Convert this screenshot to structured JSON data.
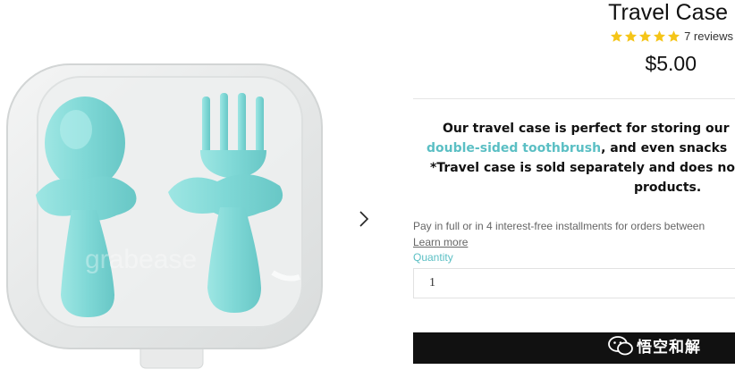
{
  "product": {
    "title": "Travel Case",
    "rating_value": 5,
    "rating_max": 5,
    "reviews_label": "7 reviews",
    "price": "$5.00"
  },
  "description": {
    "line1": "Our travel case is perfect for storing our",
    "link_text": "double-sided toothbrush",
    "line2_rest": ", and even snacks",
    "line3": "*Travel case is sold separately and does no",
    "line4": "products."
  },
  "payment": {
    "installments_text": "Pay in full or in 4 interest-free installments for orders between",
    "learn_more_label": "Learn more"
  },
  "quantity": {
    "label": "Quantity",
    "value": "1"
  },
  "image": {
    "embossed_text": "grabease"
  },
  "watermark": {
    "text": "悟空和解"
  },
  "colors": {
    "accent": "#5bbfc4",
    "star": "#f5c518",
    "button": "#111111",
    "utensil": "#7fd8d6"
  }
}
